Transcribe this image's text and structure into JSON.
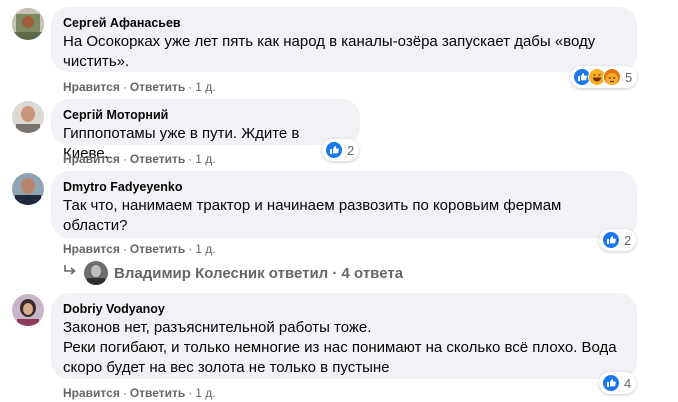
{
  "comments": [
    {
      "author": "Сергей Афанасьев",
      "text": "На Осокорках уже лет пять как народ в каналы-озёра запускает дабы «воду чистить».",
      "like": "Нравится",
      "reply": "Ответить",
      "time": "1 д.",
      "reaction_count": "5",
      "reactions": [
        "like-icon",
        "haha-icon",
        "angry-icon"
      ]
    },
    {
      "author": "Сергій Моторний",
      "text": "Гиппопотамы уже в пути. Ждите в Киеве.",
      "like": "Нравится",
      "reply": "Ответить",
      "time": "1 д.",
      "reaction_count": "2",
      "reactions": [
        "like-icon"
      ]
    },
    {
      "author": "Dmytro Fadyeyenko",
      "text": "Так что, нанимаем трактор и начинаем развозить по коровьим фермам области?",
      "like": "Нравится",
      "reply": "Ответить",
      "time": "1 д.",
      "reaction_count": "2",
      "reactions": [
        "like-icon"
      ]
    },
    {
      "author": "Dobriy Vodyanoy",
      "text": "Законов нет, разъяснительной работы тоже.\nРеки погибают, и только немногие из нас понимают на сколько всё плохо. Вода скоро будет на вес золота не только в пустыне",
      "like": "Нравится",
      "reply": "Ответить",
      "time": "1 д.",
      "reaction_count": "4",
      "reactions": [
        "like-icon"
      ]
    }
  ],
  "replies_summary": {
    "text": "Владимир Колесник ответил · 4 ответа"
  },
  "separator": "·",
  "colors": {
    "bubble": "#f0f2f5",
    "secondary_text": "#65676b",
    "like_blue": "#1877f2"
  }
}
